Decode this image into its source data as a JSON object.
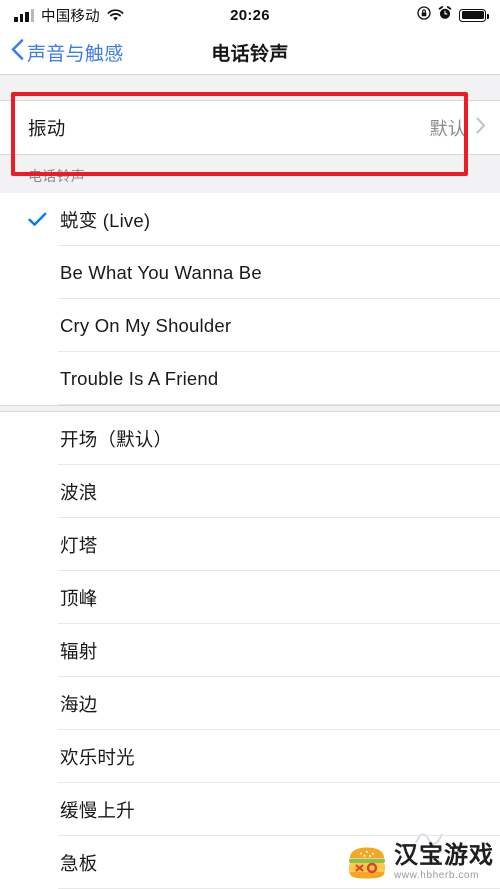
{
  "status_bar": {
    "carrier": "中国移动",
    "time": "20:26",
    "signal_icon": "cellular-signal-icon",
    "wifi_icon": "wifi-icon",
    "rotation_lock_icon": "rotation-lock-icon",
    "alarm_icon": "alarm-clock-icon",
    "battery_icon": "battery-full-icon"
  },
  "nav": {
    "back_label": "声音与触感",
    "back_icon": "chevron-left-icon",
    "title": "电话铃声"
  },
  "vibration_row": {
    "label": "振动",
    "value": "默认",
    "chevron_icon": "chevron-right-icon"
  },
  "section": {
    "header": "电话铃声"
  },
  "custom_tones": [
    {
      "label": "蜕变 (Live)",
      "selected": true
    },
    {
      "label": "Be What You Wanna Be",
      "selected": false
    },
    {
      "label": "Cry On My Shoulder",
      "selected": false
    },
    {
      "label": "Trouble Is A Friend",
      "selected": false
    }
  ],
  "system_tones": [
    {
      "label": "开场（默认）",
      "selected": false
    },
    {
      "label": "波浪",
      "selected": false
    },
    {
      "label": "灯塔",
      "selected": false
    },
    {
      "label": "顶峰",
      "selected": false
    },
    {
      "label": "辐射",
      "selected": false
    },
    {
      "label": "海边",
      "selected": false
    },
    {
      "label": "欢乐时光",
      "selected": false
    },
    {
      "label": "缓慢上升",
      "selected": false
    },
    {
      "label": "急板",
      "selected": false
    }
  ],
  "annotation": {
    "shape": "red-rectangle-highlight",
    "color": "#ED1C24",
    "targets": "vibration_row"
  },
  "watermark": {
    "title": "汉宝游戏",
    "url": "www.hbherb.com",
    "logo_icon": "burger-logo-icon"
  },
  "colors": {
    "accent_blue": "#007AFF",
    "nav_link_blue": "#3C7BEF",
    "page_background": "#F2F2F5",
    "row_background": "#FFFFFF",
    "secondary_text": "#8A8A8E",
    "annotation_red": "#ED1C24"
  }
}
